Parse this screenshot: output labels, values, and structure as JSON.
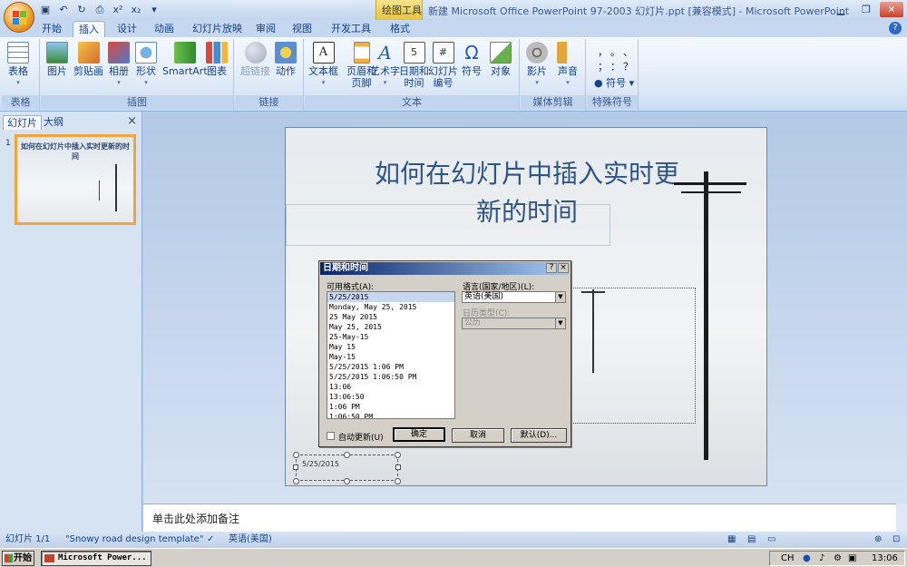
{
  "app": {
    "window_title": "新建 Microsoft Office PowerPoint 97-2003 幻灯片.ppt [兼容模式] - Microsoft PowerPoint",
    "contextual_tab_group": "绘图工具"
  },
  "tabs": [
    "开始",
    "插入",
    "设计",
    "动画",
    "幻灯片放映",
    "审阅",
    "视图",
    "开发工具",
    "格式"
  ],
  "active_tab": "插入",
  "ribbon": {
    "groups": {
      "table": "表格",
      "illustrations": "插图",
      "links": "链接",
      "text": "文本",
      "media": "媒体剪辑",
      "special": "特殊符号"
    },
    "buttons": {
      "table": "表格",
      "picture": "图片",
      "clipart": "剪贴画",
      "album": "相册",
      "shapes": "形状",
      "smartart": "SmartArt",
      "chart": "图表",
      "hyperlink": "超链接",
      "action": "动作",
      "textbox": "文本框",
      "header_footer_1": "页眉和",
      "header_footer_2": "页脚",
      "wordart": "艺术字",
      "datetime_1": "日期和",
      "datetime_2": "时间",
      "slide_number_1": "幻灯片",
      "slide_number_2": "编号",
      "symbol": "符号",
      "object": "对象",
      "movie": "影片",
      "sound": "声音",
      "special_symbol": "符号"
    },
    "special_chars": [
      "，",
      "。",
      "、",
      "；",
      "：",
      "？"
    ]
  },
  "left_pane": {
    "tab_slides": "幻灯片",
    "tab_outline": "大纲",
    "close": "×",
    "slide_number": "1",
    "thumb_title": "如何在幻灯片中插入实时更新的时间"
  },
  "slide": {
    "title_line1": "如何在幻灯片中插入实时更",
    "title_line2": "新的时间",
    "date_placeholder": "5/25/2015"
  },
  "dialog": {
    "title": "日期和时间",
    "help_btn": "?",
    "close_btn": "×",
    "formats_label": "可用格式(A):",
    "formats": [
      "5/25/2015",
      "Monday, May 25, 2015",
      "25 May 2015",
      "May 25, 2015",
      "25-May-15",
      "May 15",
      "May-15",
      "5/25/2015 1:06 PM",
      "5/25/2015 1:06:50 PM",
      "13:06",
      "13:06:50",
      "1:06 PM",
      "1:06:50 PM"
    ],
    "selected_format_index": 0,
    "language_label": "语言(国家/地区)(L):",
    "language_value": "英语(美国)",
    "calendar_label": "日历类型(C):",
    "calendar_value": "公历",
    "auto_update_label": "自动更新(U)",
    "auto_update_checked": false,
    "ok": "确定",
    "cancel": "取消",
    "default": "默认(D)..."
  },
  "notes": {
    "placeholder": "单击此处添加备注"
  },
  "statusbar": {
    "slide_count": "幻灯片 1/1",
    "template": "\"Snowy road design template\"",
    "language": "英语(美国)"
  },
  "taskbar": {
    "start": "开始",
    "task": "Microsoft Power...",
    "ime": "CH",
    "time": "13:06"
  },
  "colors": {
    "accent": "#15428b",
    "selection": "#f2a33a",
    "dialog_title": "#0a246a"
  }
}
